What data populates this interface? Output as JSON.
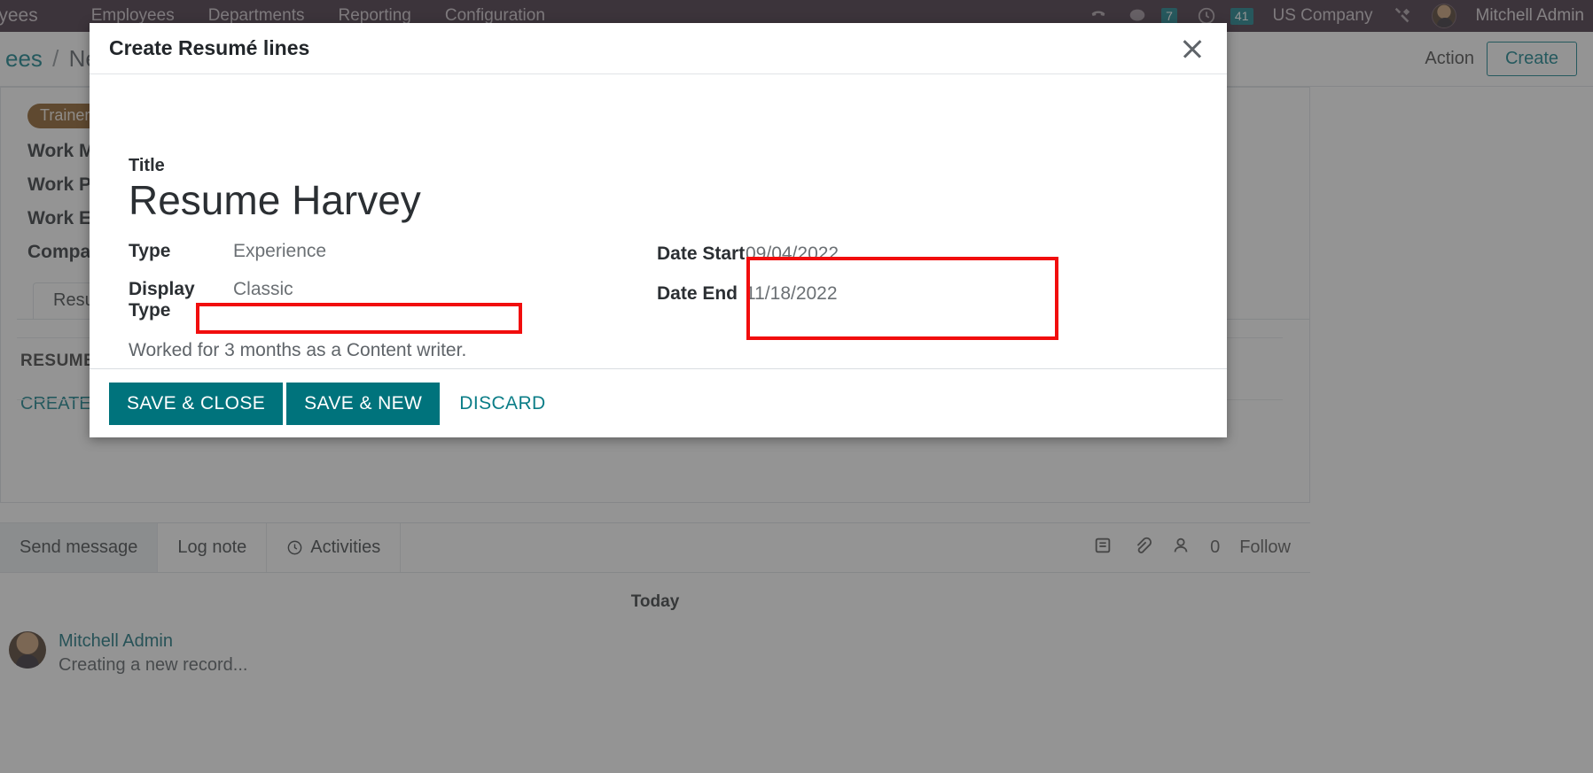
{
  "navbar": {
    "brand": "loyees",
    "menu": [
      "Employees",
      "Departments",
      "Reporting",
      "Configuration"
    ],
    "phone_icon": "phone-icon",
    "chat_icon": "chat-icon",
    "chat_badge": "7",
    "clock_icon": "clock-icon",
    "clock_badge": "41",
    "company": "US Company",
    "wrench_icon": "wrench-icon",
    "avatar": "avatar",
    "user": "Mitchell Admin"
  },
  "controlpanel": {
    "breadcrumb_root": "ees",
    "breadcrumb_sep": "/",
    "breadcrumb_current": "New",
    "action_label": "Action",
    "create_label": "Create"
  },
  "record": {
    "tag": "Trainer",
    "tag_remove": "✖",
    "fields": [
      "Work Mo",
      "Work Pho",
      "Work Ema",
      "Company"
    ],
    "tab": "Resumé",
    "section_title": "RESUME",
    "create_link": "CREATE A"
  },
  "chatter": {
    "send_message": "Send message",
    "log_note": "Log note",
    "activities": "Activities",
    "activities_icon": "clock-plus-icon",
    "log_icon": "log-icon",
    "attachment_icon": "paperclip-icon",
    "followers_icon": "followers-icon",
    "followers_count": "0",
    "follow_label": "Follow",
    "today": "Today",
    "message_author": "Mitchell Admin",
    "message_body": "Creating a new record..."
  },
  "modal": {
    "title": "Create Resumé lines",
    "close_icon": "close-icon",
    "title_label": "Title",
    "title_value": "Resume Harvey",
    "type_label": "Type",
    "type_value": "Experience",
    "display_type_label": "Display Type",
    "display_type_value": "Classic",
    "description": "Worked for 3 months as a Content writer.",
    "date_start_label": "Date Start",
    "date_start_value": "09/04/2022",
    "date_end_label": "Date End",
    "date_end_value": "11/18/2022",
    "save_close_label": "SAVE & CLOSE",
    "save_new_label": "SAVE & NEW",
    "discard_label": "DISCARD"
  },
  "colors": {
    "brand_teal": "#00737c",
    "navbar": "#3d2a3b",
    "highlight_red": "#f10d0d",
    "tag_brown": "#8a5a23"
  }
}
